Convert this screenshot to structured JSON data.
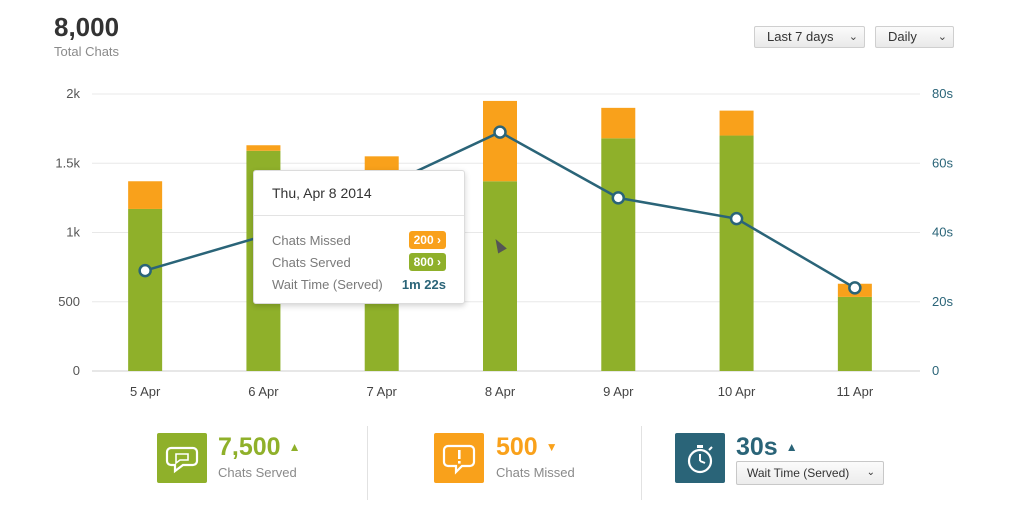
{
  "summary": {
    "total_value": "8,000",
    "total_label": "Total Chats"
  },
  "filters": {
    "range_label": "Last 7 days",
    "interval_label": "Daily"
  },
  "chart_data": {
    "type": "bar",
    "stacked": true,
    "categories": [
      "5 Apr",
      "6 Apr",
      "7 Apr",
      "8 Apr",
      "9 Apr",
      "10 Apr",
      "11 Apr"
    ],
    "series": [
      {
        "name": "Chats Served",
        "values": [
          1170,
          1590,
          1350,
          1370,
          1680,
          1700,
          535
        ],
        "color": "#8fb02a",
        "axis": "left"
      },
      {
        "name": "Chats Missed",
        "values": [
          200,
          40,
          200,
          580,
          220,
          180,
          95
        ],
        "color": "#f9a11b",
        "axis": "left"
      },
      {
        "name": "Wait Time (Served)",
        "type": "line",
        "values": [
          29,
          39,
          53,
          69,
          50,
          44,
          24
        ],
        "color": "#2a6478",
        "axis": "right"
      }
    ],
    "y_left": {
      "ticks": [
        "0",
        "500",
        "1k",
        "1.5k",
        "2k"
      ],
      "range": [
        0,
        2000
      ]
    },
    "y_right": {
      "ticks": [
        "0",
        "20s",
        "40s",
        "60s",
        "80s"
      ],
      "range": [
        0,
        80
      ]
    },
    "grid": true
  },
  "tooltip": {
    "date": "Thu, Apr 8 2014",
    "missed_label": "Chats Missed",
    "missed_value": "200",
    "served_label": "Chats Served",
    "served_value": "800",
    "wait_label": "Wait Time (Served)",
    "wait_value": "1m 22s",
    "chevron": "›"
  },
  "kpis": [
    {
      "value": "7,500",
      "label": "Chats Served",
      "trend": "up",
      "color": "#8fb02a",
      "icon": "chat-bubble-icon"
    },
    {
      "value": "500",
      "label": "Chats Missed",
      "trend": "down",
      "color": "#f9a11b",
      "icon": "chat-alert-icon"
    },
    {
      "value": "30s",
      "label": "Wait Time (Served)",
      "trend": "up",
      "color": "#2a6478",
      "icon": "stopwatch-icon"
    }
  ],
  "wait_select_label": "Wait Time (Served)",
  "arrows": {
    "up": "▲",
    "down": "▼",
    "caret": "⌄"
  }
}
